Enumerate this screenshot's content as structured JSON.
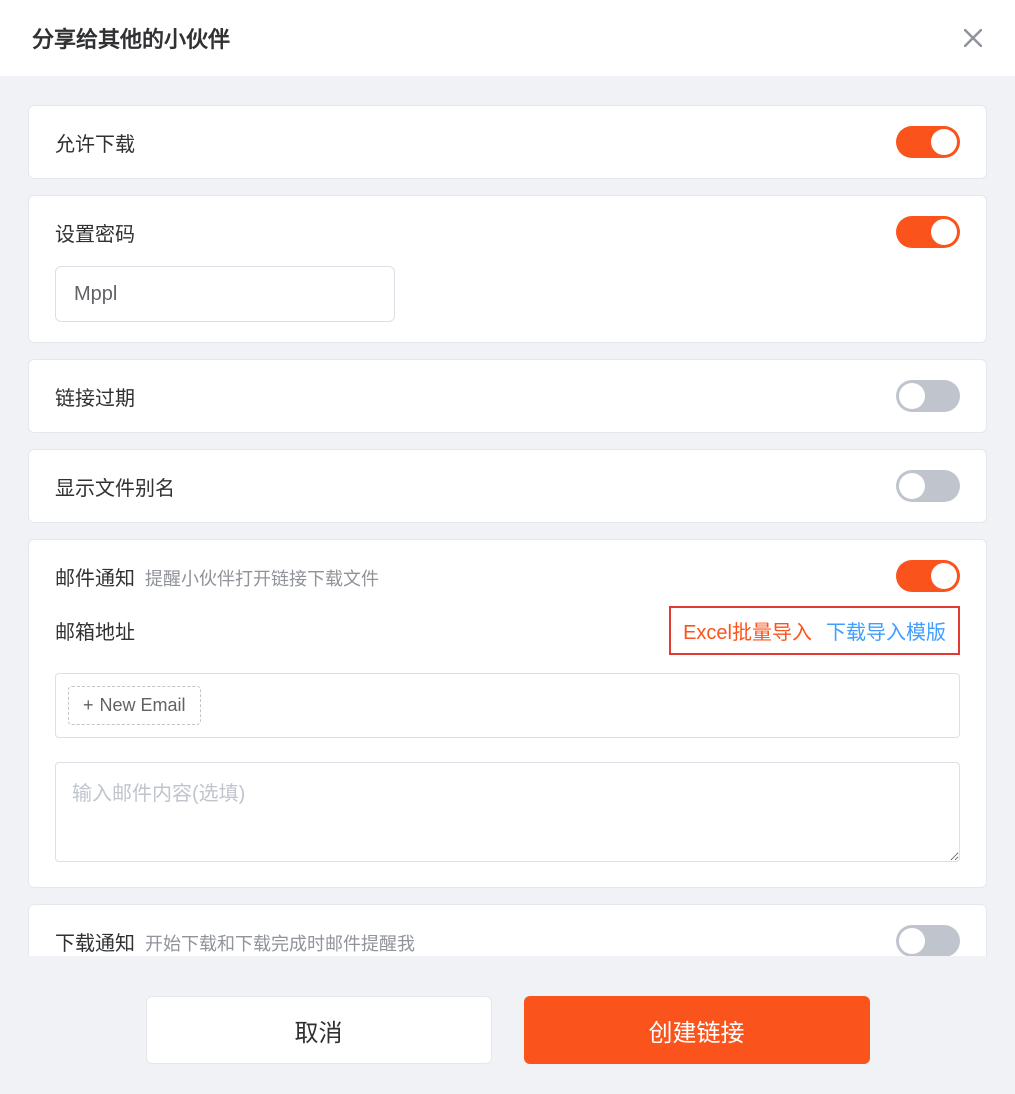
{
  "header": {
    "title": "分享给其他的小伙伴"
  },
  "options": {
    "allow_download": {
      "label": "允许下载",
      "on": true
    },
    "set_password": {
      "label": "设置密码",
      "on": true,
      "value": "Mppl"
    },
    "link_expire": {
      "label": "链接过期",
      "on": false
    },
    "show_alias": {
      "label": "显示文件别名",
      "on": false
    },
    "email_notify": {
      "label": "邮件通知",
      "hint": "提醒小伙伴打开链接下载文件",
      "on": true,
      "address_label": "邮箱地址",
      "excel_import": "Excel批量导入",
      "download_template": "下载导入模版",
      "new_email": "New Email",
      "content_placeholder": "输入邮件内容(选填)"
    },
    "download_notify": {
      "label": "下载通知",
      "hint": "开始下载和下载完成时邮件提醒我",
      "on": false
    }
  },
  "footer": {
    "cancel": "取消",
    "create": "创建链接"
  }
}
